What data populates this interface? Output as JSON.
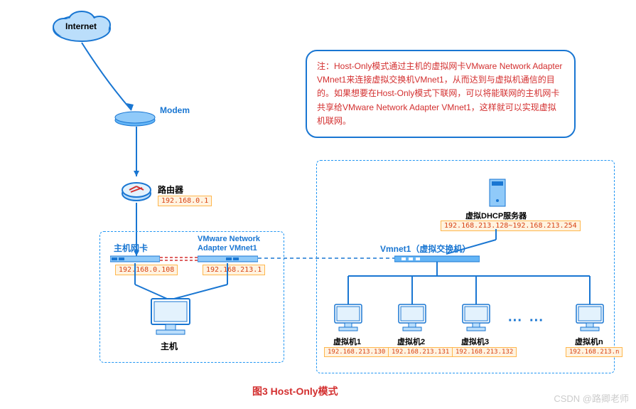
{
  "internet": {
    "label": "Internet"
  },
  "modem": {
    "label": "Modem"
  },
  "router": {
    "label": "路由器",
    "ip": "192.168.0.1"
  },
  "hostBox": {
    "hostNic": {
      "label": "主机网卡",
      "ip": "192.168.0.108"
    },
    "vmwareAdapter": {
      "label1": "VMware Network",
      "label2": "Adapter VMnet1",
      "ip": "192.168.213.1"
    },
    "host": {
      "label": "主机"
    }
  },
  "virtualBox": {
    "dhcp": {
      "label": "虚拟DHCP服务器",
      "range": "192.168.213.128~192.168.213.254"
    },
    "switch": {
      "label": "Vmnet1（虚拟交换机）"
    },
    "vms": [
      {
        "label": "虚拟机1",
        "ip": "192.168.213.130"
      },
      {
        "label": "虚拟机2",
        "ip": "192.168.213.131"
      },
      {
        "label": "虚拟机3",
        "ip": "192.168.213.132"
      },
      {
        "label": "虚拟机n",
        "ip": "192.168.213.n"
      }
    ],
    "ellipsis": "···"
  },
  "note": "注：Host-Only模式通过主机的虚拟网卡VMware Network Adapter VMnet1来连接虚拟交换机VMnet1，从而达到与虚拟机通信的目的。如果想要在Host-Only模式下联网，可以将能联网的主机网卡共享给VMware Network Adapter VMnet1，这样就可以实现虚拟机联网。",
  "caption": "图3  Host-Only模式",
  "watermark": "CSDN @路卿老师"
}
